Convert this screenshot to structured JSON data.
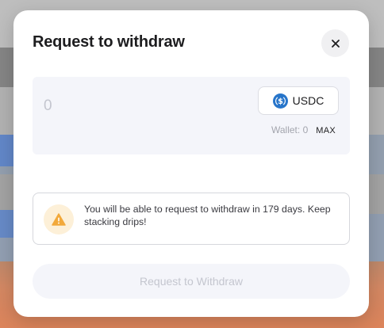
{
  "modal": {
    "title": "Request to withdraw",
    "close_icon": "close-icon"
  },
  "amount": {
    "value": "",
    "placeholder": "0"
  },
  "token": {
    "label": "USDC",
    "icon": "usdc-icon",
    "icon_color": "#2775ca"
  },
  "wallet": {
    "text": "Wallet: 0",
    "max_label": "MAX"
  },
  "notice": {
    "icon": "warning-icon",
    "icon_color": "#f2a93b",
    "text": "You will be able to request to withdraw in 179 days. Keep stacking drips!"
  },
  "submit": {
    "label": "Request to Withdraw",
    "disabled": true
  }
}
